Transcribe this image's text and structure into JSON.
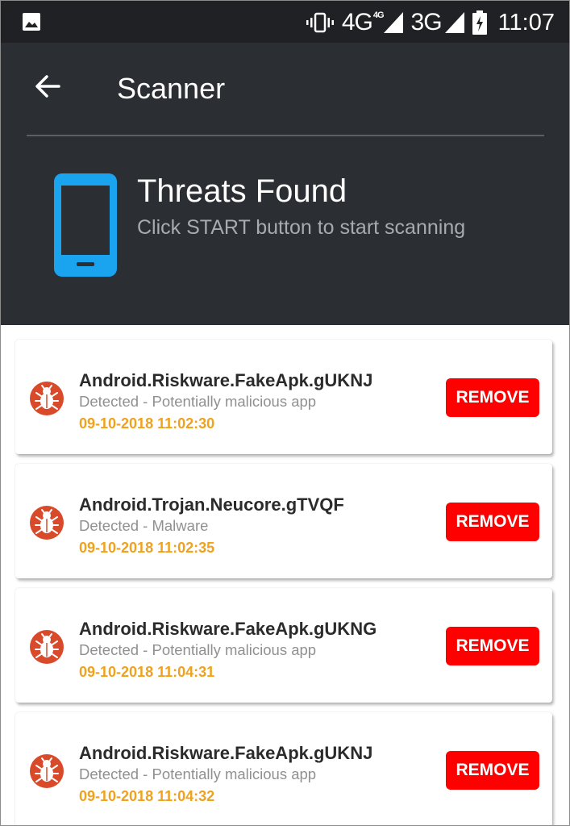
{
  "status_bar": {
    "network1": "4G",
    "network1_sup": "4G",
    "network2": "3G",
    "time": "11:07",
    "icons": [
      "image-icon",
      "vibrate-icon",
      "signal-icon",
      "battery-charging-icon"
    ]
  },
  "header": {
    "title": "Scanner",
    "back_icon": "arrow-left-icon"
  },
  "summary": {
    "icon": "phone-icon",
    "heading": "Threats Found",
    "subtitle": "Click START button to start scanning",
    "icon_color": "#1aa3ef"
  },
  "threats": [
    {
      "name": "Android.Riskware.FakeApk.gUKNJ",
      "status": "Detected - Potentially malicious app",
      "time": "09-10-2018 11:02:30",
      "action": "REMOVE"
    },
    {
      "name": "Android.Trojan.Neucore.gTVQF",
      "status": "Detected - Malware",
      "time": "09-10-2018 11:02:35",
      "action": "REMOVE"
    },
    {
      "name": "Android.Riskware.FakeApk.gUKNG",
      "status": "Detected - Potentially malicious app",
      "time": "09-10-2018 11:04:31",
      "action": "REMOVE"
    },
    {
      "name": "Android.Riskware.FakeApk.gUKNJ",
      "status": "Detected - Potentially malicious app",
      "time": "09-10-2018 11:04:32",
      "action": "REMOVE"
    }
  ],
  "colors": {
    "remove_button": "#fe0000",
    "timestamp": "#f0a21c",
    "bug_icon": "#d94a2b",
    "header_bg": "#2b2e32"
  }
}
